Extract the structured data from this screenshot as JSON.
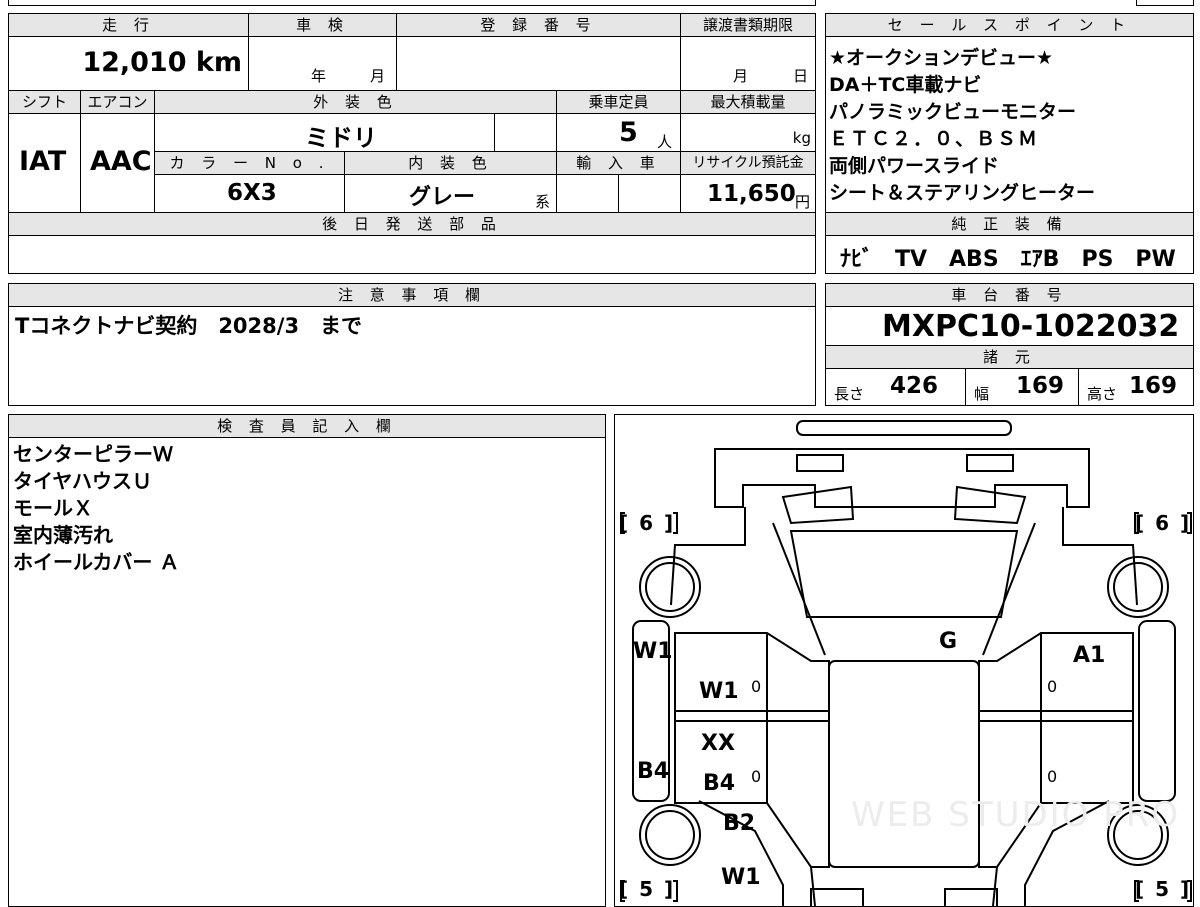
{
  "header": {
    "mileage_label": "走 行",
    "mileage_value": "12,010 km",
    "inspection_label": "車 検",
    "inspection_year": "年",
    "inspection_month": "月",
    "registration_label": "登 録 番 号",
    "transfer_label": "譲渡書類期限",
    "transfer_month": "月",
    "transfer_day": "日"
  },
  "row2": {
    "shift_label": "シフト",
    "shift_value": "IAT",
    "aircon_label": "エアコン",
    "aircon_value": "AAC",
    "exterior_label": "外 装 色",
    "exterior_value": "ミドリ",
    "capacity_label": "乗車定員",
    "capacity_value": "5",
    "capacity_unit": "人",
    "load_label": "最大積載量",
    "load_unit": "kg",
    "color_no_label": "カ ラ ー N o .",
    "color_no_value": "6X3",
    "interior_label": "内 装 色",
    "interior_value": "グレー",
    "interior_suffix": "系",
    "import_label": "輸 入 車",
    "recycle_label": "リサイクル預託金",
    "recycle_value": "11,650",
    "recycle_unit": "円"
  },
  "later_parts": {
    "label": "後 日 発 送 部 品",
    "value": ""
  },
  "sales_points": {
    "label": "セ ー ル ス ポ イ ン ト",
    "lines": [
      "★オークションデビュー★",
      "DA＋TC車載ナビ",
      "パノラミックビューモニター",
      "ＥＴＣ２．０、ＢＳＭ",
      "両側パワースライド",
      "シート＆ステアリングヒーター"
    ]
  },
  "equipment": {
    "label": "純 正 装 備",
    "value": "ﾅﾋﾞ　TV　ABS　ｴｱB　PS　PW"
  },
  "notes": {
    "label": "注 意 事 項 欄",
    "value": "Tコネクトナビ契約　2028/3　まで"
  },
  "chassis": {
    "label": "車 台 番 号",
    "value": "MXPC10-1022032"
  },
  "specs": {
    "label": "諸 元",
    "length_label": "長さ",
    "length_value": "426",
    "width_label": "幅",
    "width_value": "169",
    "height_label": "高さ",
    "height_value": "169"
  },
  "inspector": {
    "label": "検 査 員 記 入 欄",
    "lines": [
      "センターピラーＷ",
      "タイヤハウスＵ",
      "モールＸ",
      "室内薄汚れ",
      "ホイールカバー Ａ"
    ]
  },
  "diagram": {
    "tire_front_left": "[ 6 ]",
    "tire_front_right": "[ 6 ]",
    "tire_rear_left": "[ 5 ]",
    "tire_rear_right": "[ 5 ]",
    "windshield_mark": "G",
    "left_front_door": "W1",
    "left_front_door_panel": "W1",
    "left_front_door_zero": "0",
    "right_front_door": "A1",
    "right_front_door_zero": "0",
    "left_rear_door_xx": "XX",
    "left_rear_door_b4": "B4",
    "left_rear_door_zero": "0",
    "left_side_b4": "B4",
    "right_rear_door_zero": "0",
    "rear_quarter_b2": "B2",
    "rear_w1": "W1",
    "watermark": "WEB STUDIO PRO"
  }
}
